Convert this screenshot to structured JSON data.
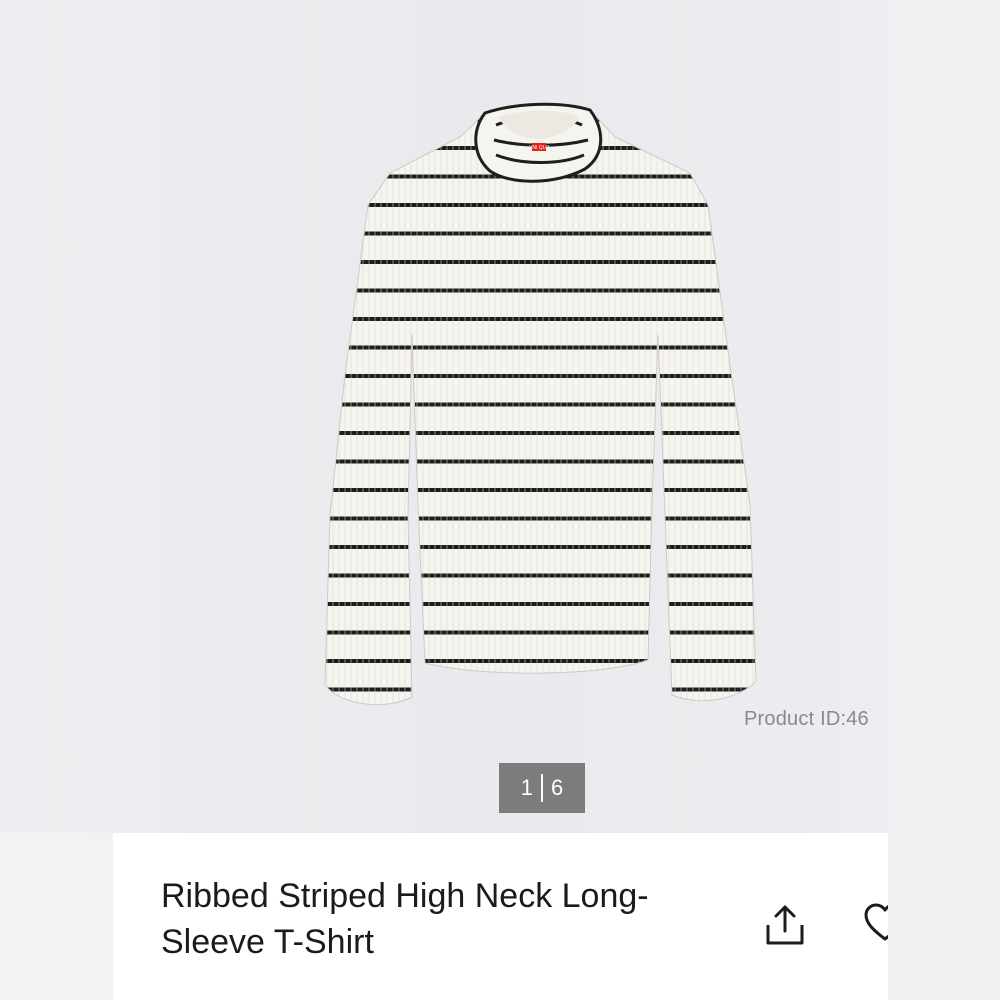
{
  "gallery": {
    "product_id_text": "Product ID:46",
    "counter": {
      "current": "1",
      "total": "6"
    },
    "image": {
      "description_icon": "striped-longsleeve-shirt",
      "logo_text": "UNI QLO"
    }
  },
  "product": {
    "title": "Ribbed Striped High Neck Long-Sleeve T-Shirt"
  },
  "actions": {
    "share_icon": "share-icon",
    "favorite_icon": "heart-icon"
  },
  "colors": {
    "background": "#e9eaed",
    "stripe": "#1e1e1e",
    "shirt": "#f6f4ef",
    "counter_bg": "#7c7c7c"
  }
}
